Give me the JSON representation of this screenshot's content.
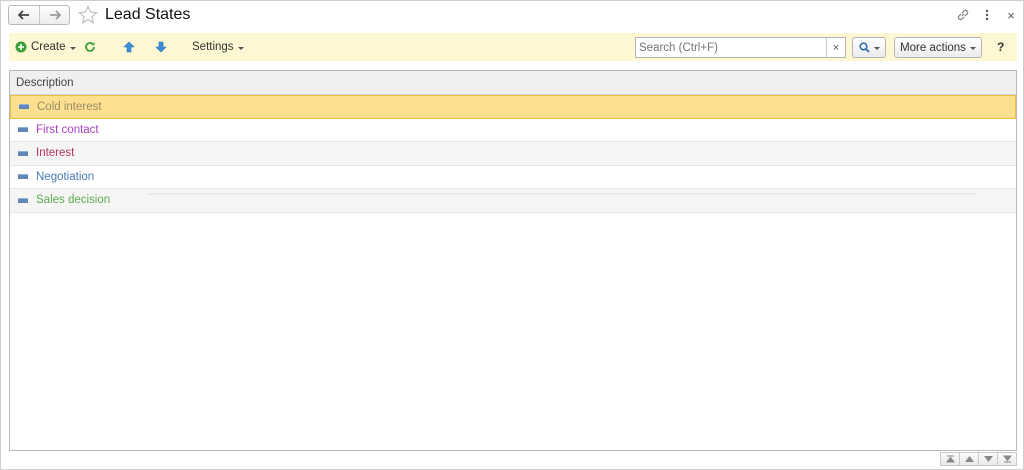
{
  "window": {
    "title": "Lead States"
  },
  "titlebar": {
    "back_icon": "arrow-left-icon",
    "forward_icon": "arrow-right-icon",
    "favorite_icon": "star-icon",
    "link_icon": "link-icon",
    "more_icon": "kebab-icon",
    "close_label": "×"
  },
  "toolbar": {
    "create_label": "Create",
    "settings_label": "Settings",
    "search_placeholder": "Search (Ctrl+F)",
    "search_value": "",
    "clear_label": "×",
    "more_actions_label": "More actions",
    "help_label": "?"
  },
  "table": {
    "columns": [
      "Description"
    ],
    "rows": [
      {
        "description": "Cold interest",
        "color": "#9c8c64",
        "selected": true
      },
      {
        "description": "First contact",
        "color": "#a63fbf"
      },
      {
        "description": "Interest",
        "color": "#b8335e"
      },
      {
        "description": "Negotiation",
        "color": "#4a79b8"
      },
      {
        "description": "Sales decision",
        "color": "#5faa53"
      }
    ]
  },
  "colors": {
    "command_bar": "#fdf7d3",
    "selection": "#fce08f",
    "accent_green": "#3aa23a",
    "accent_blue": "#3b8fd8"
  }
}
